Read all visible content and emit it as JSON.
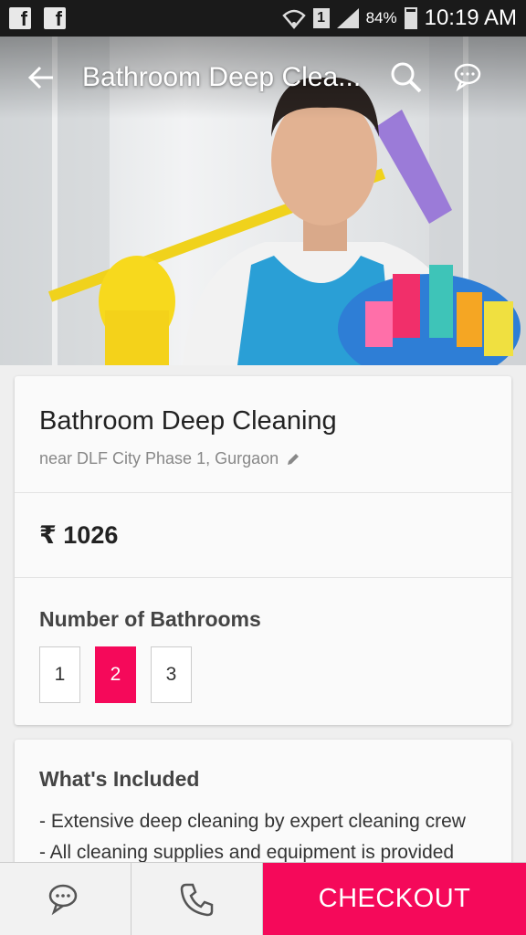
{
  "status_bar": {
    "notifications": [
      "facebook-icon",
      "facebook-icon"
    ],
    "sim": "1",
    "battery": "84%",
    "time": "10:19 AM"
  },
  "app_bar": {
    "title": "Bathroom Deep Clea...",
    "icons": [
      "back-arrow-icon",
      "search-icon",
      "chat-icon"
    ]
  },
  "service": {
    "title": "Bathroom Deep Cleaning",
    "location": "near DLF City Phase 1, Gurgaon",
    "price": "₹ 1026"
  },
  "bathrooms": {
    "label": "Number of Bathrooms",
    "options": [
      "1",
      "2",
      "3"
    ],
    "selected": "2"
  },
  "included": {
    "title": "What's Included",
    "items": [
      "- Extensive deep cleaning by expert cleaning crew",
      "- All cleaning supplies and equipment is provided"
    ]
  },
  "bottom_bar": {
    "checkout_label": "CHECKOUT",
    "icons": [
      "chat-icon",
      "phone-icon"
    ]
  },
  "colors": {
    "accent": "#f5095a",
    "status_bar": "#1a1a1a"
  }
}
